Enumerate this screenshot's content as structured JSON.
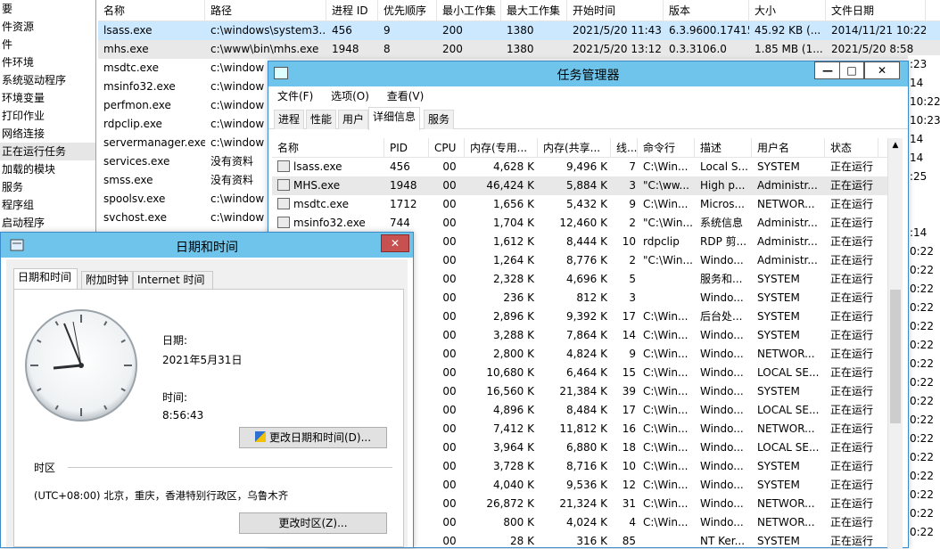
{
  "tree": {
    "items": [
      "要",
      "件资源",
      "件",
      "件环境",
      "系统驱动程序",
      "环境变量",
      "打印作业",
      "网络连接",
      "正在运行任务",
      "加载的模块",
      "服务",
      "程序组",
      "启动程序"
    ],
    "selected_index": 8
  },
  "background_list": {
    "headers": [
      "名称",
      "路径",
      "进程 ID",
      "优先顺序",
      "最小工作集",
      "最大工作集",
      "开始时间",
      "版本",
      "大小",
      "文件日期"
    ],
    "rows": [
      [
        "lsass.exe",
        "c:\\windows\\system3...",
        "456",
        "9",
        "200",
        "1380",
        "2021/5/20 11:43",
        "6.3.9600.17415",
        "45.92 KB (...",
        "2014/11/21 10:22"
      ],
      [
        "mhs.exe",
        "c:\\www\\bin\\mhs.exe",
        "1948",
        "8",
        "200",
        "1380",
        "2021/5/20 13:12",
        "0.3.3106.0",
        "1.85 MB (1...",
        "2021/5/20 8:58"
      ],
      [
        "msdtc.exe",
        "c:\\window",
        "",
        "",
        "",
        "",
        "",
        "",
        "",
        ""
      ],
      [
        "msinfo32.exe",
        "c:\\window",
        "",
        "",
        "",
        "",
        "",
        "",
        "",
        ""
      ],
      [
        "perfmon.exe",
        "c:\\window",
        "",
        "",
        "",
        "",
        "",
        "",
        "",
        ""
      ],
      [
        "rdpclip.exe",
        "c:\\window",
        "",
        "",
        "",
        "",
        "",
        "",
        "",
        ""
      ],
      [
        "servermanager.exe",
        "c:\\window",
        "",
        "",
        "",
        "",
        "",
        "",
        "",
        ""
      ],
      [
        "services.exe",
        "没有资料",
        "",
        "",
        "",
        "",
        "",
        "",
        "",
        ""
      ],
      [
        "smss.exe",
        "没有资料",
        "",
        "",
        "",
        "",
        "",
        "",
        "",
        ""
      ],
      [
        "spoolsv.exe",
        "c:\\window",
        "",
        "",
        "",
        "",
        "",
        "",
        "",
        ""
      ],
      [
        "svchost.exe",
        "c:\\window",
        "",
        "",
        "",
        "",
        "",
        "",
        "",
        ""
      ]
    ],
    "right_edge": [
      ":23",
      "14",
      "10:22",
      "10:23",
      "14",
      "14",
      ":25",
      "",
      "",
      ":14",
      "0:22",
      "0:22",
      "0:22",
      "0:22",
      "0:22",
      "0:22",
      "0:22",
      "0:22",
      "0:22",
      "0:22",
      "0:22",
      "0:22",
      "0:22",
      "0:22",
      "0:22",
      "0:22"
    ]
  },
  "task_manager": {
    "title": "任务管理器",
    "buttons": {
      "minimize": "—",
      "maximize": "□",
      "close": "✕"
    },
    "menu": [
      "文件(F)",
      "选项(O)",
      "查看(V)"
    ],
    "tabs": [
      "进程",
      "性能",
      "用户",
      "详细信息",
      "服务"
    ],
    "active_tab": 3,
    "columns": [
      "名称",
      "PID",
      "CPU",
      "内存(专用...",
      "内存(共享...",
      "线...",
      "命令行",
      "描述",
      "用户名",
      "状态"
    ],
    "rows": [
      [
        "lsass.exe",
        "456",
        "00",
        "4,628 K",
        "9,496 K",
        "7",
        "C:\\Win...",
        "Local S...",
        "SYSTEM",
        "正在运行"
      ],
      [
        "MHS.exe",
        "1948",
        "00",
        "46,424 K",
        "5,884 K",
        "3",
        "\"C:\\ww...",
        "High p...",
        "Administr...",
        "正在运行"
      ],
      [
        "msdtc.exe",
        "1712",
        "00",
        "1,656 K",
        "5,432 K",
        "9",
        "C:\\Win...",
        "Micros...",
        "NETWOR...",
        "正在运行"
      ],
      [
        "msinfo32.exe",
        "744",
        "00",
        "1,704 K",
        "12,460 K",
        "2",
        "\"C:\\Win...",
        "系统信息",
        "Administr...",
        "正在运行"
      ],
      [
        "",
        "",
        "00",
        "1,612 K",
        "8,444 K",
        "10",
        "rdpclip",
        "RDP 剪...",
        "Administr...",
        "正在运行"
      ],
      [
        "",
        "",
        "00",
        "1,264 K",
        "8,776 K",
        "2",
        "\"C:\\Win...",
        "Windo...",
        "Administr...",
        "正在运行"
      ],
      [
        "",
        "",
        "00",
        "2,328 K",
        "4,696 K",
        "5",
        "",
        "服务和...",
        "SYSTEM",
        "正在运行"
      ],
      [
        "",
        "",
        "00",
        "236 K",
        "812 K",
        "3",
        "",
        "Windo...",
        "SYSTEM",
        "正在运行"
      ],
      [
        "",
        "",
        "00",
        "2,896 K",
        "9,392 K",
        "17",
        "C:\\Win...",
        "后台处...",
        "SYSTEM",
        "正在运行"
      ],
      [
        "",
        "",
        "00",
        "3,288 K",
        "7,864 K",
        "14",
        "C:\\Win...",
        "Windo...",
        "SYSTEM",
        "正在运行"
      ],
      [
        "",
        "",
        "00",
        "2,800 K",
        "4,824 K",
        "9",
        "C:\\Win...",
        "Windo...",
        "NETWOR...",
        "正在运行"
      ],
      [
        "",
        "",
        "00",
        "10,680 K",
        "6,464 K",
        "15",
        "C:\\Win...",
        "Windo...",
        "LOCAL SE...",
        "正在运行"
      ],
      [
        "",
        "",
        "00",
        "16,560 K",
        "21,384 K",
        "39",
        "C:\\Win...",
        "Windo...",
        "SYSTEM",
        "正在运行"
      ],
      [
        "",
        "",
        "00",
        "4,896 K",
        "8,484 K",
        "17",
        "C:\\Win...",
        "Windo...",
        "LOCAL SE...",
        "正在运行"
      ],
      [
        "",
        "",
        "00",
        "7,412 K",
        "11,812 K",
        "16",
        "C:\\Win...",
        "Windo...",
        "NETWOR...",
        "正在运行"
      ],
      [
        "",
        "",
        "00",
        "3,964 K",
        "6,880 K",
        "18",
        "C:\\Win...",
        "Windo...",
        "LOCAL SE...",
        "正在运行"
      ],
      [
        "",
        "",
        "00",
        "3,728 K",
        "8,716 K",
        "10",
        "C:\\Win...",
        "Windo...",
        "SYSTEM",
        "正在运行"
      ],
      [
        "",
        "",
        "00",
        "4,040 K",
        "9,536 K",
        "12",
        "C:\\Win...",
        "Windo...",
        "SYSTEM",
        "正在运行"
      ],
      [
        "",
        "",
        "00",
        "26,872 K",
        "21,324 K",
        "31",
        "C:\\Win...",
        "Windo...",
        "NETWOR...",
        "正在运行"
      ],
      [
        "",
        "",
        "00",
        "800 K",
        "4,024 K",
        "4",
        "C:\\Win...",
        "Windo...",
        "NETWOR...",
        "正在运行"
      ],
      [
        "",
        "",
        "00",
        "28 K",
        "316 K",
        "85",
        "",
        "NT Ker...",
        "SYSTEM",
        "正在运行"
      ]
    ]
  },
  "datetime": {
    "title": "日期和时间",
    "close": "✕",
    "tabs": [
      "日期和时间",
      "附加时钟",
      "Internet 时间"
    ],
    "date_label": "日期:",
    "date_value": "2021年5月31日",
    "time_label": "时间:",
    "time_value": "8:56:43",
    "change_datetime_btn": "更改日期和时间(D)...",
    "timezone_section": "时区",
    "timezone_value": "(UTC+08:00) 北京，重庆，香港特别行政区，乌鲁木齐",
    "change_timezone_btn": "更改时区(Z)..."
  }
}
